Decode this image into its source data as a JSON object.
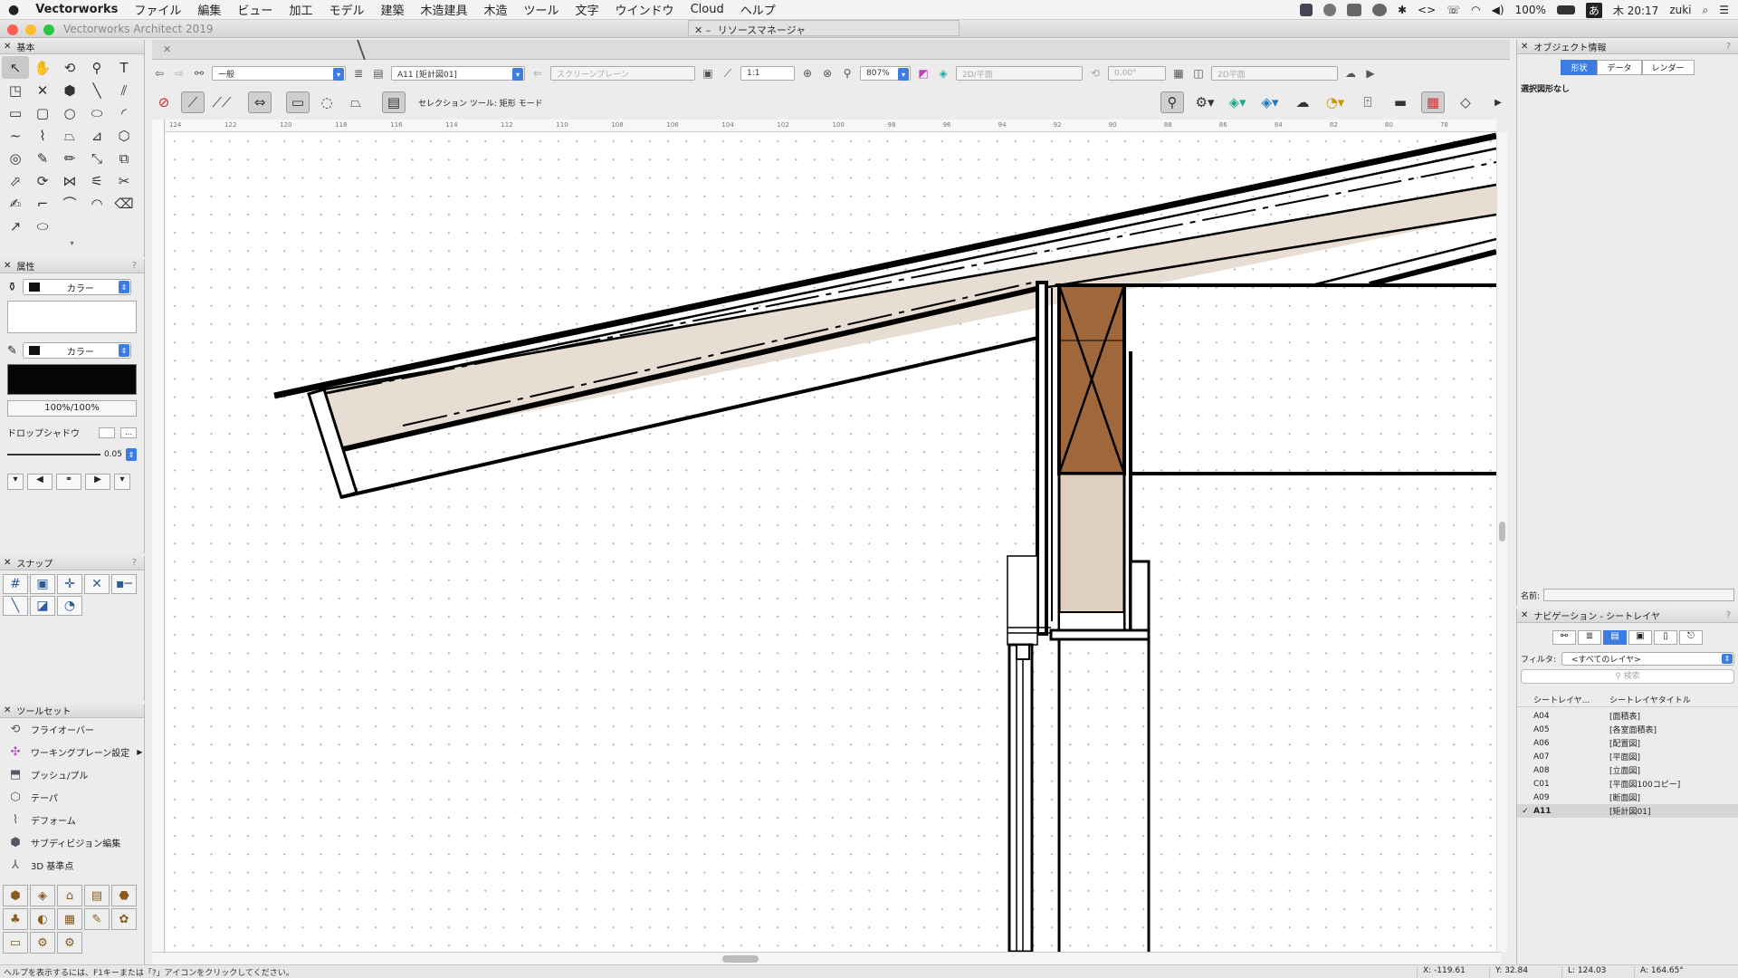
{
  "menubar": {
    "apple": "",
    "app": "Vectorworks",
    "items": [
      "ファイル",
      "編集",
      "ビュー",
      "加工",
      "モデル",
      "建築",
      "木造建具",
      "木造",
      "ツール",
      "文字",
      "ウインドウ",
      "Cloud",
      "ヘルプ"
    ],
    "battery": "100%",
    "time": "木 20:17",
    "user": "zuki"
  },
  "window": {
    "title": "Vectorworks Architect 2019",
    "resource_manager": "リソースマネージャ"
  },
  "left": {
    "basic": {
      "title": "基本",
      "help": "?"
    },
    "attributes": {
      "title": "属性",
      "fill_label": "カラー",
      "pen_label": "カラー",
      "opacity": "100%/100%",
      "drop_shadow": "ドロップシャドウ",
      "line_weight": "0.05"
    },
    "snap": {
      "title": "スナップ",
      "help": "?"
    },
    "toolsets": {
      "title": "ツールセット",
      "items": [
        {
          "label": "フライオーバー",
          "icon": "flyover-icon"
        },
        {
          "label": "ワーキングプレーン設定",
          "icon": "working-plane-icon"
        },
        {
          "label": "プッシュ/プル",
          "icon": "push-pull-icon"
        },
        {
          "label": "テーパ",
          "icon": "taper-icon"
        },
        {
          "label": "デフォーム",
          "icon": "deform-icon"
        },
        {
          "label": "サブディビジョン編集",
          "icon": "subdivision-icon"
        },
        {
          "label": "3D 基準点",
          "icon": "3d-locus-icon"
        }
      ]
    }
  },
  "viewbar": {
    "class": "一般",
    "layer": "A11 [矩計図01]",
    "plane": "スクリーンプレーン",
    "scale": "1:1",
    "zoom": "807%",
    "view": "2D/平面",
    "rotation": "0.00°",
    "render": "2D平面"
  },
  "modebar": {
    "mode_text": "セレクション ツール: 矩形 モード"
  },
  "ruler": {
    "ticks": [
      "124",
      "122",
      "120",
      "118",
      "116",
      "114",
      "112",
      "110",
      "108",
      "106",
      "104",
      "102",
      "100",
      "98",
      "96",
      "94",
      "92",
      "90",
      "88",
      "86",
      "84",
      "82",
      "80",
      "78"
    ]
  },
  "status": {
    "help": "ヘルプを表示するには、F1キーまたは「?」アイコンをクリックしてください。",
    "x": "X: -119.61",
    "y": "Y: 32.84",
    "l": "L: 124.03",
    "a": "A: 164.65°"
  },
  "oip": {
    "title": "オブジェクト情報",
    "tabs": [
      "形状",
      "データ",
      "レンダー"
    ],
    "selection": "選択図形なし",
    "name_label": "名前:"
  },
  "nav": {
    "title": "ナビゲーション - シートレイヤ",
    "filter_label": "フィルタ:",
    "filter_value": "<すべてのレイヤ>",
    "search_placeholder": "検索",
    "col1": "シートレイヤ...",
    "col2": "シートレイヤタイトル",
    "rows": [
      {
        "check": "",
        "id": "A04",
        "title": "[面積表]"
      },
      {
        "check": "",
        "id": "A05",
        "title": "[各室面積表]"
      },
      {
        "check": "",
        "id": "A06",
        "title": "[配置図]"
      },
      {
        "check": "",
        "id": "A07",
        "title": "[平面図]"
      },
      {
        "check": "",
        "id": "A08",
        "title": "[立面図]"
      },
      {
        "check": "",
        "id": "C01",
        "title": "[平面図100コピー]"
      },
      {
        "check": "",
        "id": "A09",
        "title": "[断面図]"
      },
      {
        "check": "✓",
        "id": "A11",
        "title": "[矩計図01]"
      }
    ]
  },
  "colors": {
    "accent": "#3d7de0",
    "wood": "#a0673a",
    "roof_fill": "#e8ddd3",
    "wall_fill": "#dfcfbf"
  }
}
